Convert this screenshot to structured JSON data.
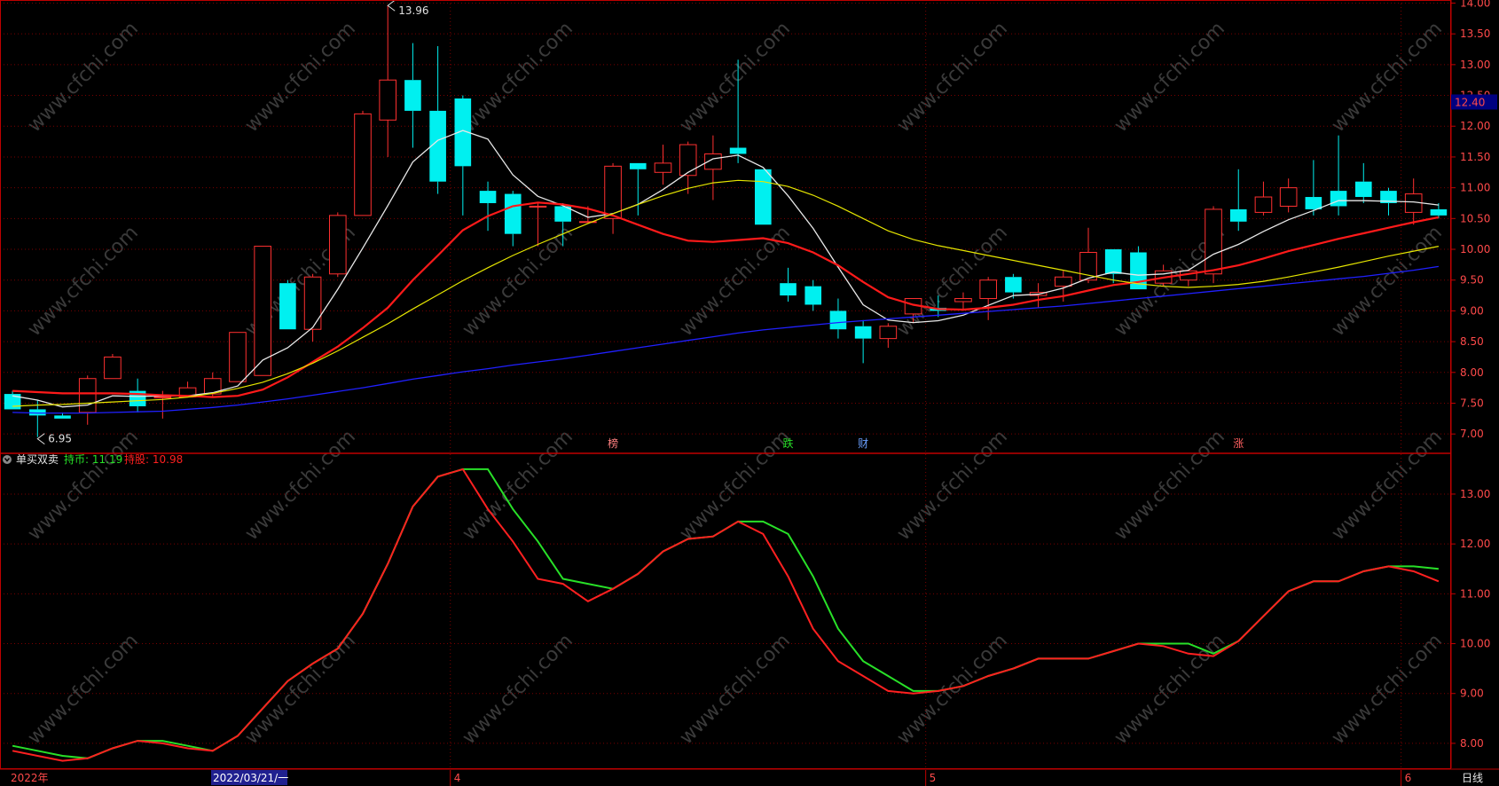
{
  "colors": {
    "background": "#000000",
    "grid": "#7a0000",
    "axis": "#c00000",
    "tick_text": "#ff4a4a",
    "candle_up": "#ff3030",
    "candle_down": "#00f0f0",
    "ma5": "#e8e8e8",
    "ma10": "#ff1a1a",
    "ma20": "#e6e600",
    "ma60": "#2020ff",
    "hold_coin": "#28e028",
    "hold_share": "#ff2020"
  },
  "main_panel": {
    "price_ticks": [
      "14.00",
      "13.50",
      "13.00",
      "12.50",
      "12.00",
      "11.50",
      "11.00",
      "10.50",
      "10.00",
      "9.50",
      "9.00",
      "8.50",
      "8.00",
      "7.50",
      "7.00"
    ],
    "current_price_tag": "12.40",
    "high_label": "13.96",
    "low_label": "6.95",
    "event_markers": [
      {
        "label": "榜",
        "index": 24,
        "color": "#ff8080"
      },
      {
        "label": "跌",
        "index": 31,
        "color": "#28e028"
      },
      {
        "label": "财",
        "index": 34,
        "color": "#6aa0ff"
      },
      {
        "label": "涨",
        "index": 49,
        "color": "#ff6060"
      }
    ]
  },
  "indicator_panel": {
    "name": "单买双卖",
    "series_a_label": "持币: 11.19",
    "series_b_label": "持股: 10.98",
    "ticks": [
      "13.00",
      "12.00",
      "11.00",
      "10.00",
      "9.00",
      "8.00"
    ]
  },
  "bottom_bar": {
    "year_label": "2022年",
    "cursor_date": "2022/03/21/一",
    "month_labels": [
      {
        "label": "4",
        "index": 18
      },
      {
        "label": "5",
        "index": 37
      },
      {
        "label": "6",
        "index": 56
      }
    ],
    "period": "日线"
  },
  "watermark": "www.cfchi.com",
  "chart_data": [
    {
      "type": "candlestick",
      "ylim": [
        6.7,
        14.05
      ],
      "x": [
        "1",
        "2",
        "3",
        "4",
        "5",
        "6",
        "7",
        "8",
        "9",
        "10",
        "11",
        "12",
        "13",
        "14",
        "15",
        "16",
        "17",
        "18",
        "19",
        "20",
        "21",
        "22",
        "23",
        "24",
        "25",
        "26",
        "27",
        "28",
        "29",
        "30",
        "31",
        "32",
        "33",
        "34",
        "35",
        "36",
        "37",
        "38",
        "39",
        "40",
        "41",
        "42",
        "43",
        "44",
        "45",
        "46",
        "47",
        "48",
        "49",
        "50",
        "51",
        "52",
        "53",
        "54",
        "55",
        "56",
        "57",
        "58"
      ],
      "open": [
        7.65,
        7.4,
        7.3,
        7.35,
        7.9,
        7.7,
        7.6,
        7.6,
        7.65,
        7.85,
        7.95,
        9.45,
        8.7,
        9.6,
        10.55,
        12.1,
        12.75,
        12.25,
        12.45,
        10.95,
        10.9,
        10.7,
        10.7,
        10.45,
        10.5,
        11.4,
        11.25,
        11.2,
        11.3,
        11.65,
        11.3,
        9.45,
        9.4,
        9.0,
        8.75,
        8.55,
        8.95,
        9.05,
        9.15,
        9.2,
        9.55,
        9.25,
        9.4,
        9.5,
        10.0,
        9.95,
        9.45,
        9.5,
        9.6,
        10.65,
        10.6,
        10.7,
        10.85,
        10.95,
        11.1,
        10.95,
        10.6,
        10.65
      ],
      "close": [
        7.4,
        7.3,
        7.25,
        7.9,
        8.25,
        7.45,
        7.6,
        7.75,
        7.9,
        8.65,
        10.05,
        8.7,
        9.55,
        10.55,
        12.2,
        12.75,
        12.25,
        11.1,
        11.35,
        10.75,
        10.25,
        10.7,
        10.45,
        10.45,
        11.35,
        11.3,
        11.4,
        11.7,
        11.55,
        11.55,
        10.4,
        9.25,
        9.1,
        8.7,
        8.55,
        8.75,
        9.2,
        9.0,
        9.2,
        9.5,
        9.3,
        9.3,
        9.55,
        9.95,
        9.6,
        9.35,
        9.65,
        9.65,
        10.65,
        10.45,
        10.85,
        11.0,
        10.65,
        10.7,
        10.85,
        10.75,
        10.9,
        10.55
      ],
      "high": [
        7.7,
        7.55,
        7.35,
        7.95,
        8.3,
        7.9,
        7.7,
        7.85,
        8.0,
        8.65,
        10.05,
        9.5,
        9.6,
        10.6,
        12.25,
        13.96,
        13.35,
        13.3,
        12.5,
        11.1,
        10.95,
        10.75,
        10.75,
        10.7,
        11.4,
        11.4,
        11.7,
        11.75,
        11.85,
        13.08,
        11.05,
        9.7,
        9.5,
        9.2,
        8.85,
        8.8,
        9.2,
        9.25,
        9.3,
        9.55,
        9.6,
        9.45,
        9.65,
        10.35,
        10.0,
        10.05,
        9.75,
        9.65,
        10.7,
        11.3,
        11.1,
        11.15,
        11.45,
        11.85,
        11.4,
        11.0,
        11.15,
        10.75
      ],
      "low": [
        7.4,
        6.95,
        7.25,
        7.15,
        7.9,
        7.35,
        7.25,
        7.6,
        7.6,
        7.9,
        7.95,
        8.7,
        8.5,
        9.55,
        10.55,
        11.5,
        11.65,
        10.9,
        10.55,
        10.3,
        10.05,
        10.05,
        10.05,
        10.45,
        10.25,
        10.55,
        11.05,
        10.9,
        10.8,
        11.4,
        10.4,
        9.15,
        9.0,
        8.55,
        8.15,
        8.4,
        8.8,
        8.9,
        9.0,
        8.85,
        9.2,
        9.05,
        9.15,
        9.45,
        9.45,
        9.35,
        9.4,
        9.4,
        9.45,
        10.3,
        10.55,
        10.6,
        10.55,
        10.55,
        10.75,
        10.55,
        10.4,
        10.5
      ],
      "series": [
        {
          "name": "MA5",
          "values": [
            7.62,
            7.55,
            7.44,
            7.47,
            7.62,
            7.61,
            7.62,
            7.62,
            7.67,
            7.78,
            8.2,
            8.4,
            8.73,
            9.35,
            10.02,
            10.71,
            11.42,
            11.77,
            11.93,
            11.79,
            11.21,
            10.86,
            10.71,
            10.52,
            10.58,
            10.73,
            10.97,
            11.25,
            11.47,
            11.53,
            11.33,
            10.87,
            10.34,
            9.71,
            9.1,
            8.85,
            8.81,
            8.84,
            8.93,
            9.09,
            9.25,
            9.27,
            9.37,
            9.53,
            9.63,
            9.58,
            9.6,
            9.66,
            9.92,
            10.08,
            10.29,
            10.48,
            10.63,
            10.79,
            10.79,
            10.78,
            10.77,
            10.72
          ]
        },
        {
          "name": "MA10",
          "values": [
            7.7,
            7.68,
            7.66,
            7.66,
            7.66,
            7.65,
            7.63,
            7.62,
            7.6,
            7.62,
            7.72,
            7.92,
            8.17,
            8.42,
            8.72,
            9.05,
            9.5,
            9.9,
            10.31,
            10.54,
            10.7,
            10.76,
            10.73,
            10.66,
            10.55,
            10.4,
            10.25,
            10.14,
            10.12,
            10.15,
            10.18,
            10.1,
            9.95,
            9.74,
            9.47,
            9.22,
            9.1,
            9.03,
            9.02,
            9.05,
            9.1,
            9.18,
            9.24,
            9.33,
            9.42,
            9.47,
            9.54,
            9.6,
            9.66,
            9.74,
            9.85,
            9.97,
            10.07,
            10.17,
            10.26,
            10.35,
            10.44,
            10.52
          ]
        },
        {
          "name": "MA20",
          "values": [
            7.45,
            7.47,
            7.48,
            7.5,
            7.52,
            7.54,
            7.56,
            7.6,
            7.66,
            7.74,
            7.84,
            7.98,
            8.15,
            8.35,
            8.57,
            8.79,
            9.03,
            9.26,
            9.49,
            9.7,
            9.9,
            10.08,
            10.25,
            10.42,
            10.58,
            10.73,
            10.87,
            10.99,
            11.08,
            11.12,
            11.1,
            11.02,
            10.88,
            10.7,
            10.5,
            10.3,
            10.16,
            10.06,
            9.98,
            9.9,
            9.82,
            9.74,
            9.66,
            9.58,
            9.5,
            9.44,
            9.4,
            9.38,
            9.4,
            9.43,
            9.48,
            9.55,
            9.63,
            9.71,
            9.8,
            9.89,
            9.97,
            10.05
          ]
        },
        {
          "name": "MA60",
          "values": [
            7.35,
            7.34,
            7.34,
            7.34,
            7.35,
            7.36,
            7.37,
            7.4,
            7.43,
            7.47,
            7.52,
            7.57,
            7.63,
            7.69,
            7.75,
            7.82,
            7.89,
            7.95,
            8.01,
            8.06,
            8.12,
            8.17,
            8.22,
            8.28,
            8.34,
            8.4,
            8.46,
            8.52,
            8.58,
            8.64,
            8.69,
            8.73,
            8.77,
            8.81,
            8.84,
            8.87,
            8.9,
            8.93,
            8.96,
            8.99,
            9.02,
            9.05,
            9.08,
            9.12,
            9.16,
            9.2,
            9.24,
            9.28,
            9.32,
            9.36,
            9.4,
            9.44,
            9.48,
            9.52,
            9.56,
            9.61,
            9.66,
            9.72
          ]
        }
      ]
    },
    {
      "type": "line",
      "ylim": [
        7.5,
        13.8
      ],
      "x": [
        "1",
        "2",
        "3",
        "4",
        "5",
        "6",
        "7",
        "8",
        "9",
        "10",
        "11",
        "12",
        "13",
        "14",
        "15",
        "16",
        "17",
        "18",
        "19",
        "20",
        "21",
        "22",
        "23",
        "24",
        "25",
        "26",
        "27",
        "28",
        "29",
        "30",
        "31",
        "32",
        "33",
        "34",
        "35",
        "36",
        "37",
        "38",
        "39",
        "40",
        "41",
        "42",
        "43",
        "44",
        "45",
        "46",
        "47",
        "48",
        "49",
        "50",
        "51",
        "52",
        "53",
        "54",
        "55",
        "56",
        "57",
        "58"
      ],
      "series": [
        {
          "name": "持币",
          "values": [
            7.95,
            7.85,
            7.75,
            7.7,
            7.9,
            8.05,
            8.05,
            7.95,
            7.85,
            8.15,
            8.7,
            9.25,
            9.6,
            9.9,
            10.6,
            11.6,
            12.75,
            13.35,
            13.5,
            13.5,
            12.7,
            12.05,
            11.3,
            11.2,
            11.1,
            11.4,
            11.85,
            12.1,
            12.15,
            12.45,
            12.45,
            12.2,
            11.35,
            10.3,
            9.65,
            9.35,
            9.05,
            9.05,
            9.15,
            9.35,
            9.5,
            9.7,
            9.7,
            9.7,
            9.85,
            10.0,
            10.0,
            10.0,
            9.8,
            10.05,
            10.55,
            11.05,
            11.25,
            11.25,
            11.45,
            11.55,
            11.55,
            11.5,
            11.25
          ]
        },
        {
          "name": "持股",
          "values": [
            7.85,
            7.75,
            7.65,
            7.7,
            7.9,
            8.05,
            8.0,
            7.9,
            7.85,
            8.15,
            8.7,
            9.25,
            9.6,
            9.9,
            10.6,
            11.6,
            12.75,
            13.35,
            13.5,
            12.7,
            12.05,
            11.3,
            11.2,
            10.85,
            11.1,
            11.4,
            11.85,
            12.1,
            12.15,
            12.45,
            12.2,
            11.35,
            10.3,
            9.65,
            9.35,
            9.05,
            9.0,
            9.05,
            9.15,
            9.35,
            9.5,
            9.7,
            9.7,
            9.7,
            9.85,
            10.0,
            9.95,
            9.8,
            9.75,
            10.05,
            10.55,
            11.05,
            11.25,
            11.25,
            11.45,
            11.55,
            11.45,
            11.25,
            10.98
          ]
        }
      ]
    }
  ]
}
